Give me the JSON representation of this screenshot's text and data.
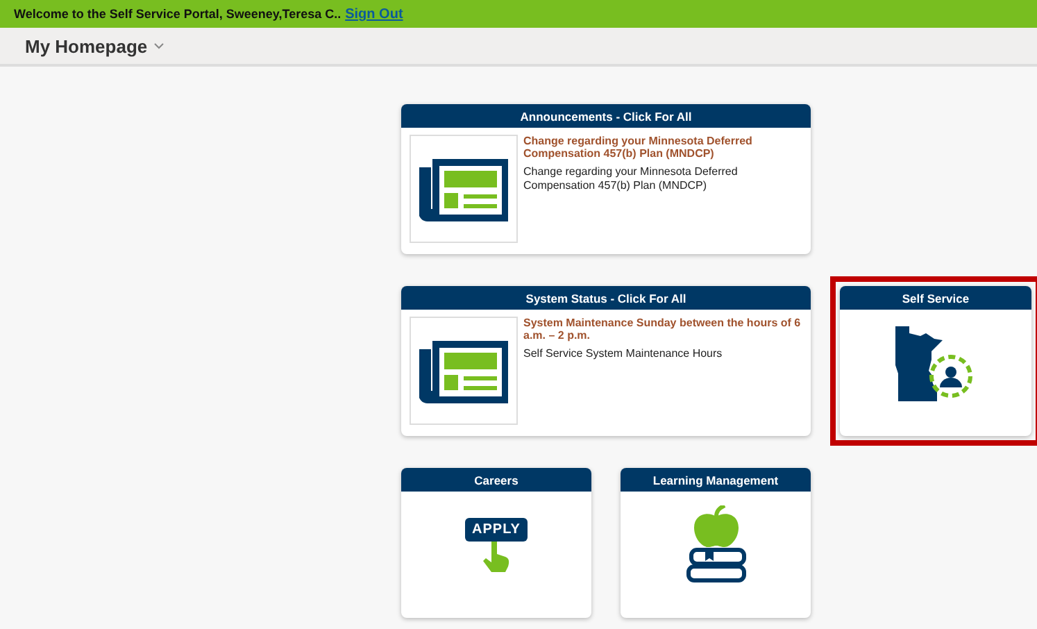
{
  "banner": {
    "welcome": "Welcome to the Self Service Portal, Sweeney,Teresa C..",
    "link": "Sign Out"
  },
  "header": {
    "title": "My Homepage"
  },
  "tiles": [
    {
      "kind": "news",
      "title": "Announcements - Click For All",
      "headline": "Change regarding your Minnesota Deferred Compensation 457(b) Plan (MNDCP)",
      "body": "Change regarding your Minnesota Deferred Compensation 457(b) Plan (MNDCP)",
      "highlighted": false
    },
    {
      "kind": "news",
      "title": "System Status - Click For All",
      "headline": "System Maintenance Sunday between the hours of 6 a.m. – 2 p.m.",
      "body": "Self Service System Maintenance Hours",
      "highlighted": false
    },
    {
      "kind": "selfservice",
      "title": "Self Service",
      "highlighted": true
    },
    {
      "kind": "careers",
      "title": "Careers",
      "icon_text": "APPLY",
      "highlighted": false
    },
    {
      "kind": "learning",
      "title": "Learning Management",
      "highlighted": false
    }
  ]
}
